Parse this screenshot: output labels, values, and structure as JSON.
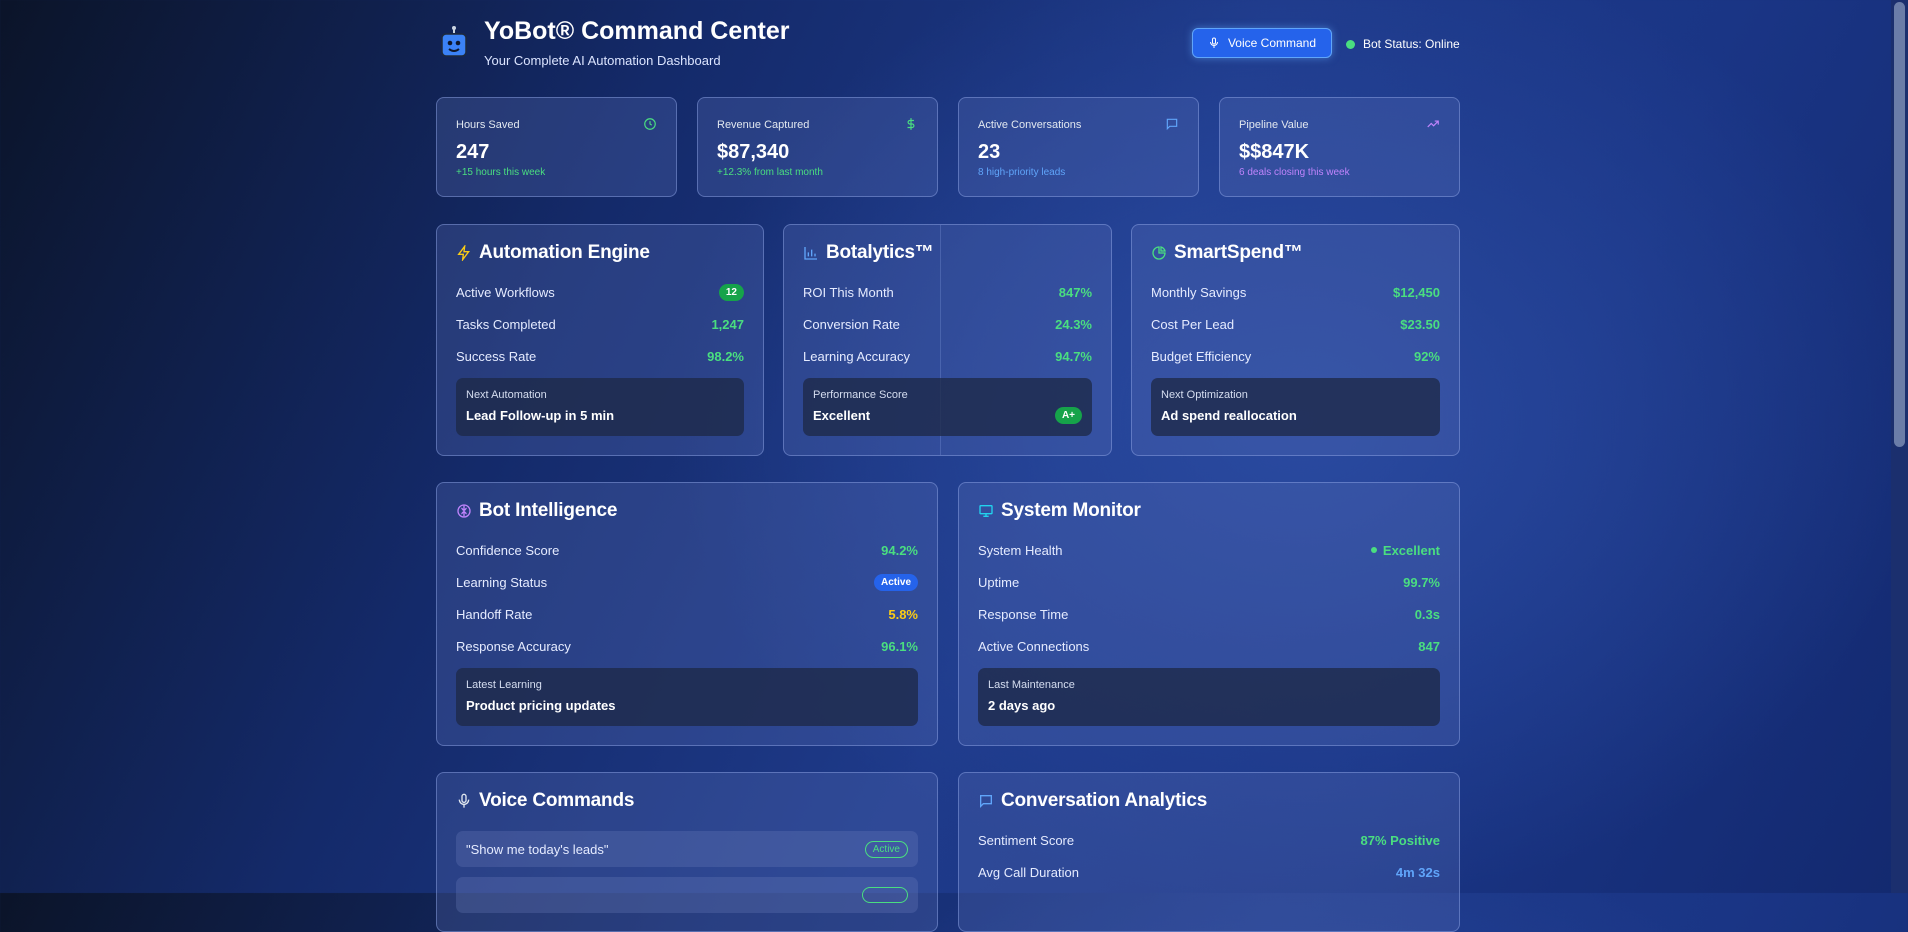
{
  "header": {
    "title": "YoBot® Command Center",
    "subtitle": "Your Complete AI Automation Dashboard",
    "voice_button": "Voice Command",
    "bot_status": "Bot Status: Online"
  },
  "stats": [
    {
      "label": "Hours Saved",
      "value": "247",
      "sub": "+15 hours this week",
      "icon": "clock-icon"
    },
    {
      "label": "Revenue Captured",
      "value": "$87,340",
      "sub": "+12.3% from last month",
      "icon": "dollar-icon"
    },
    {
      "label": "Active Conversations",
      "value": "23",
      "sub": "8 high-priority leads",
      "icon": "chat-icon"
    },
    {
      "label": "Pipeline Value",
      "value": "$$847K",
      "sub": "6 deals closing this week",
      "icon": "trending-up-icon"
    }
  ],
  "automation": {
    "title": "Automation Engine",
    "rows": [
      {
        "label": "Active Workflows",
        "value": "12"
      },
      {
        "label": "Tasks Completed",
        "value": "1,247"
      },
      {
        "label": "Success Rate",
        "value": "98.2%"
      }
    ],
    "box_label": "Next Automation",
    "box_value": "Lead Follow-up in 5 min"
  },
  "botalytics": {
    "title": "Botalytics™",
    "rows": [
      {
        "label": "ROI This Month",
        "value": "847%"
      },
      {
        "label": "Conversion Rate",
        "value": "24.3%"
      },
      {
        "label": "Learning Accuracy",
        "value": "94.7%"
      }
    ],
    "box_label": "Performance Score",
    "box_value": "Excellent",
    "box_badge": "A+"
  },
  "smartspend": {
    "title": "SmartSpend™",
    "rows": [
      {
        "label": "Monthly Savings",
        "value": "$12,450"
      },
      {
        "label": "Cost Per Lead",
        "value": "$23.50"
      },
      {
        "label": "Budget Efficiency",
        "value": "92%"
      }
    ],
    "box_label": "Next Optimization",
    "box_value": "Ad spend reallocation"
  },
  "intelligence": {
    "title": "Bot Intelligence",
    "rows": [
      {
        "label": "Confidence Score",
        "value": "94.2%"
      },
      {
        "label": "Learning Status",
        "value": "Active"
      },
      {
        "label": "Handoff Rate",
        "value": "5.8%"
      },
      {
        "label": "Response Accuracy",
        "value": "96.1%"
      }
    ],
    "box_label": "Latest Learning",
    "box_value": "Product pricing updates"
  },
  "monitor": {
    "title": "System Monitor",
    "rows": [
      {
        "label": "System Health",
        "value": "Excellent"
      },
      {
        "label": "Uptime",
        "value": "99.7%"
      },
      {
        "label": "Response Time",
        "value": "0.3s"
      },
      {
        "label": "Active Connections",
        "value": "847"
      }
    ],
    "box_label": "Last Maintenance",
    "box_value": "2 days ago"
  },
  "voice": {
    "title": "Voice Commands",
    "commands": [
      {
        "text": "\"Show me today's leads\"",
        "status": "Active"
      }
    ]
  },
  "analytics": {
    "title": "Conversation Analytics",
    "rows": [
      {
        "label": "Sentiment Score",
        "value": "87% Positive"
      },
      {
        "label": "Avg Call Duration",
        "value": "4m 32s"
      }
    ]
  }
}
